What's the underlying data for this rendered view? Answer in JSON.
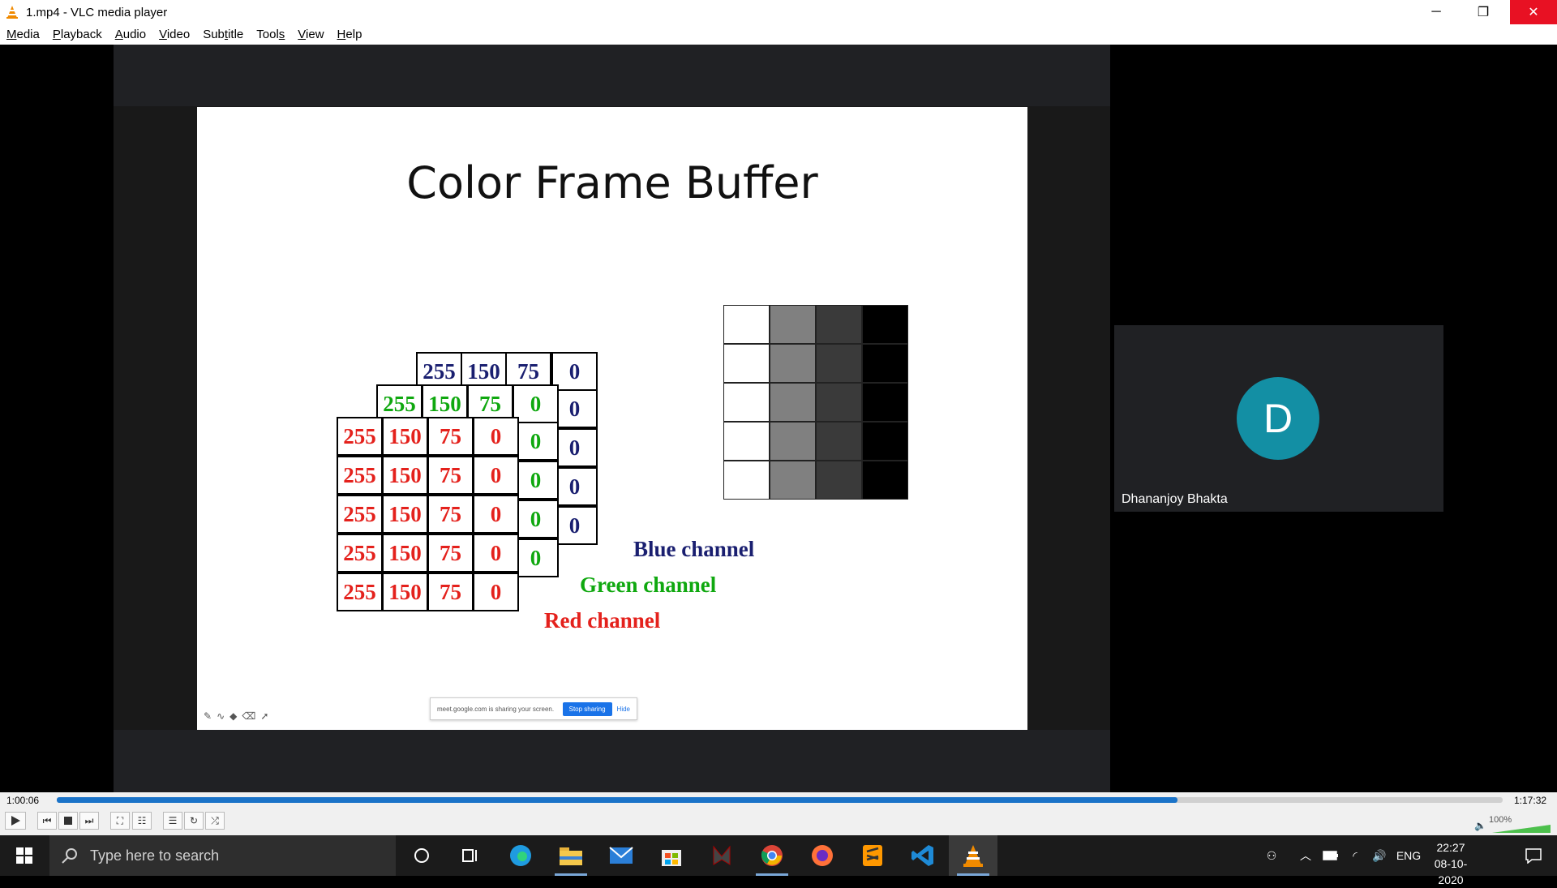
{
  "window": {
    "title": "1.mp4 - VLC media player",
    "minimize_glyph": "─",
    "maximize_glyph": "❐",
    "close_glyph": "✕"
  },
  "menu": [
    {
      "underline": "M",
      "rest": "edia"
    },
    {
      "underline": "P",
      "rest": "layback"
    },
    {
      "underline": "A",
      "rest": "udio"
    },
    {
      "underline": "V",
      "rest": "ideo"
    },
    {
      "pre": "Sub",
      "underline": "t",
      "rest": "itle"
    },
    {
      "pre": "Tool",
      "underline": "s",
      "rest": ""
    },
    {
      "underline": "V",
      "rest": "iew"
    },
    {
      "underline": "H",
      "rest": "elp"
    }
  ],
  "slide": {
    "title": "Color Frame Buffer",
    "blue_row": [
      "255",
      "150",
      "75",
      "0"
    ],
    "blue_col": [
      "0",
      "0",
      "0",
      "0"
    ],
    "green_row": [
      "255",
      "150",
      "75",
      "0"
    ],
    "green_col": [
      "0",
      "0",
      "0",
      "0"
    ],
    "red_rows": [
      [
        "255",
        "150",
        "75",
        "0"
      ],
      [
        "255",
        "150",
        "75",
        "0"
      ],
      [
        "255",
        "150",
        "75",
        "0"
      ],
      [
        "255",
        "150",
        "75",
        "0"
      ],
      [
        "255",
        "150",
        "75",
        "0"
      ]
    ],
    "labels": {
      "blue": "Blue channel",
      "green": "Green channel",
      "red": "Red channel"
    },
    "gray_columns": [
      "#ffffff",
      "#808080",
      "#3a3a3a",
      "#000000"
    ],
    "share_bar": {
      "text": "meet.google.com is sharing your screen.",
      "stop_label": "Stop sharing",
      "hide_label": "Hide"
    }
  },
  "participant": {
    "initial": "D",
    "name": "Dhananjoy Bhakta",
    "avatar_color": "#138fa4"
  },
  "controls": {
    "elapsed": "1:00:06",
    "total": "1:17:32",
    "progress_fraction": 0.775,
    "volume": "100%",
    "volume_fraction": 1.0,
    "buttons": [
      "play",
      "previous",
      "stop",
      "next",
      "fullscreen",
      "extended-settings",
      "playlist",
      "loop",
      "random"
    ]
  },
  "taskbar": {
    "search_placeholder": "Type here to search",
    "language": "ENG",
    "time": "22:27",
    "date": "08-10-2020",
    "apps": [
      "cortana",
      "task-view",
      "edge",
      "file-explorer",
      "mail",
      "store",
      "predator",
      "chrome",
      "firefox",
      "sublime-text",
      "vscode",
      "vlc"
    ]
  },
  "colors": {
    "accent": "#1a73c8",
    "blue_channel": "#1a1f70",
    "green_channel": "#0fa80f",
    "red_channel": "#e4211c",
    "close_red": "#e81123"
  }
}
